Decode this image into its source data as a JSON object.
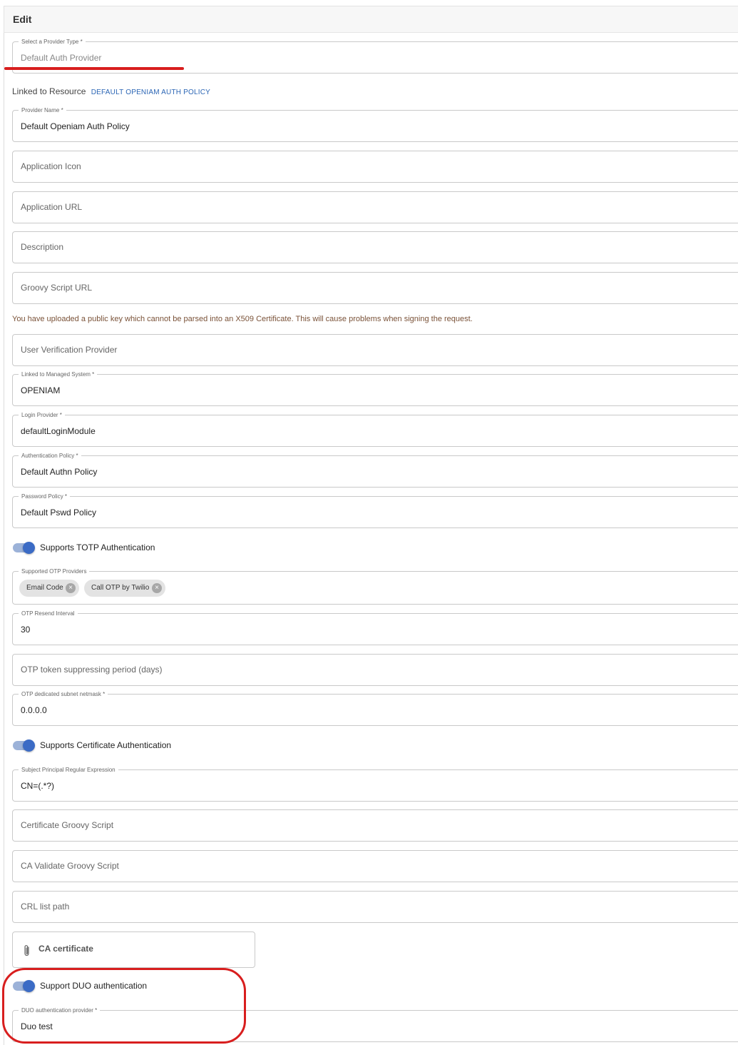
{
  "header": {
    "title": "Edit"
  },
  "provider_type": {
    "legend": "Select a Provider Type *",
    "value": "Default Auth Provider"
  },
  "linked_resource": {
    "label": "Linked to Resource",
    "link": "DEFAULT OPENIAM AUTH POLICY"
  },
  "provider_name": {
    "legend": "Provider Name *",
    "value": "Default Openiam Auth Policy"
  },
  "application_icon": {
    "placeholder": "Application Icon"
  },
  "application_url": {
    "placeholder": "Application URL"
  },
  "description": {
    "placeholder": "Description"
  },
  "groovy_script_url": {
    "placeholder": "Groovy Script URL"
  },
  "warning": "You have uploaded a public key which cannot be parsed into an X509 Certificate. This will cause problems when signing the request.",
  "user_verification_provider": {
    "placeholder": "User Verification Provider"
  },
  "managed_system": {
    "legend": "Linked to Managed System *",
    "value": "OPENIAM"
  },
  "login_provider": {
    "legend": "Login Provider *",
    "value": "defaultLoginModule"
  },
  "authentication_policy": {
    "legend": "Authentication Policy *",
    "value": "Default Authn Policy"
  },
  "password_policy": {
    "legend": "Password Policy *",
    "value": "Default Pswd Policy"
  },
  "totp_toggle": {
    "label": "Supports TOTP Authentication",
    "on": true
  },
  "otp_providers": {
    "legend": "Supported OTP Providers",
    "chips": [
      "Email Code",
      "Call OTP by Twilio"
    ]
  },
  "otp_resend_interval": {
    "legend": "OTP Resend Interval",
    "value": "30"
  },
  "otp_token_suppressing": {
    "placeholder": "OTP token suppressing period (days)"
  },
  "otp_subnet_netmask": {
    "legend": "OTP dedicated subnet netmask *",
    "value": "0.0.0.0"
  },
  "certificate_toggle": {
    "label": "Supports Certificate Authentication",
    "on": true
  },
  "subject_principal_regex": {
    "legend": "Subject Principal Regular Expression",
    "value": "CN=(.*?)"
  },
  "certificate_groovy_script": {
    "placeholder": "Certificate Groovy Script"
  },
  "ca_validate_groovy_script": {
    "placeholder": "CA Validate Groovy Script"
  },
  "crl_list_path": {
    "placeholder": "CRL list path"
  },
  "ca_certificate": {
    "label": "CA certificate",
    "icon": "paperclip-icon"
  },
  "duo_toggle": {
    "label": "Support DUO authentication",
    "on": true
  },
  "duo_provider": {
    "legend": "DUO authentication provider *",
    "value": "Duo test"
  },
  "colors": {
    "accent": "#3b6bc5",
    "link": "#2c66b5",
    "annotation": "#d81e1e"
  }
}
